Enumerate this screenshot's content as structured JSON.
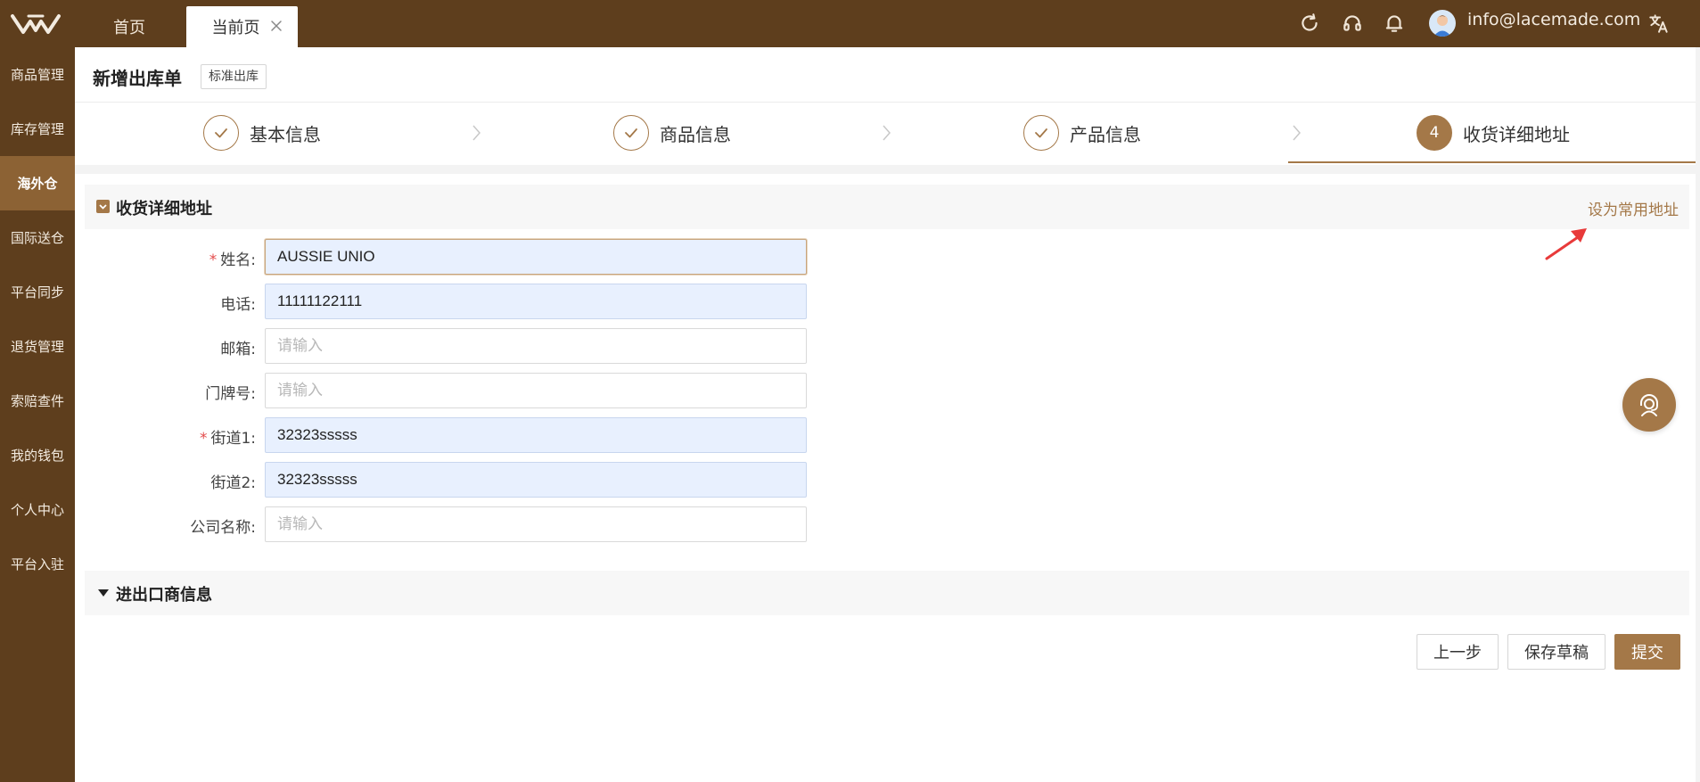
{
  "topbar": {
    "tabs": [
      {
        "label": "首页"
      },
      {
        "label": "当前页"
      }
    ],
    "user_email": "info@lacemade.com",
    "icons": [
      "refresh-icon",
      "headset-icon",
      "bell-icon",
      "avatar",
      "translate-icon"
    ]
  },
  "sidebar": {
    "items": [
      {
        "label": "商品管理"
      },
      {
        "label": "库存管理"
      },
      {
        "label": "海外仓",
        "active": true
      },
      {
        "label": "国际送仓"
      },
      {
        "label": "平台同步"
      },
      {
        "label": "退货管理"
      },
      {
        "label": "索赔查件"
      },
      {
        "label": "我的钱包"
      },
      {
        "label": "个人中心"
      },
      {
        "label": "平台入驻"
      }
    ]
  },
  "page": {
    "title": "新增出库单",
    "type_badge": "标准出库"
  },
  "steps": [
    {
      "index": "1",
      "label": "基本信息",
      "status": "done"
    },
    {
      "index": "2",
      "label": "商品信息",
      "status": "done"
    },
    {
      "index": "3",
      "label": "产品信息",
      "status": "done"
    },
    {
      "index": "4",
      "label": "收货详细地址",
      "status": "active"
    }
  ],
  "address_section": {
    "title": "收货详细地址",
    "set_default_link": "设为常用地址",
    "fields": [
      {
        "label": "姓名:",
        "required": true,
        "value": "AUSSIE UNIO",
        "placeholder": "请输入"
      },
      {
        "label": "电话:",
        "required": false,
        "value": "11111122111",
        "placeholder": "请输入"
      },
      {
        "label": "邮箱:",
        "required": false,
        "value": "",
        "placeholder": "请输入"
      },
      {
        "label": "门牌号:",
        "required": false,
        "value": "",
        "placeholder": "请输入"
      },
      {
        "label": "街道1:",
        "required": true,
        "value": "32323sssss",
        "placeholder": "请输入"
      },
      {
        "label": "街道2:",
        "required": false,
        "value": "32323sssss",
        "placeholder": "请输入"
      },
      {
        "label": "公司名称:",
        "required": false,
        "value": "",
        "placeholder": "请输入"
      }
    ]
  },
  "importer_section": {
    "title": "进出口商信息"
  },
  "actions": {
    "prev": "上一步",
    "save_draft": "保存草稿",
    "submit": "提交"
  },
  "colors": {
    "brand_dark": "#5e3e1d",
    "brand_accent": "#a47848",
    "sidebar_active": "#8c6234",
    "autofill_bg": "#e8f0fe",
    "required_mark": "#e34b4b"
  }
}
